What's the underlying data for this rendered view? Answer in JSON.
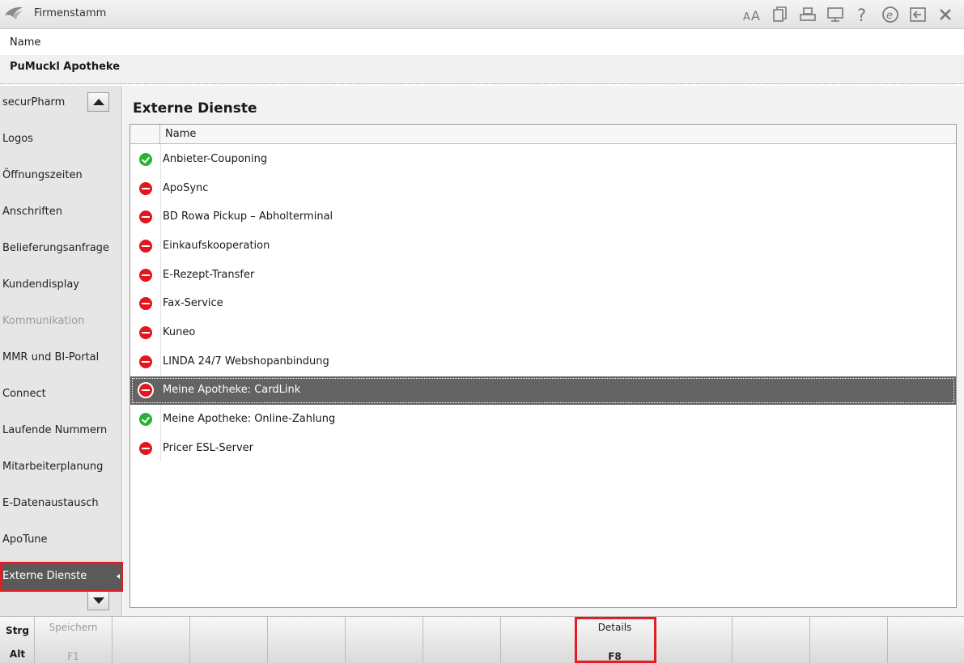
{
  "window": {
    "title": "Firmenstamm"
  },
  "header": {
    "name_label": "Name",
    "name_value": "PuMuckl Apotheke"
  },
  "sidebar": {
    "items": [
      {
        "label": "securPharm",
        "state": "normal"
      },
      {
        "label": "Logos",
        "state": "normal"
      },
      {
        "label": "Öffnungszeiten",
        "state": "normal"
      },
      {
        "label": "Anschriften",
        "state": "normal"
      },
      {
        "label": "Belieferungsanfrage",
        "state": "normal"
      },
      {
        "label": "Kundendisplay",
        "state": "normal"
      },
      {
        "label": "Kommunikation",
        "state": "disabled"
      },
      {
        "label": "MMR und BI-Portal",
        "state": "normal"
      },
      {
        "label": "Connect",
        "state": "normal"
      },
      {
        "label": "Laufende Nummern",
        "state": "normal"
      },
      {
        "label": "Mitarbeiterplanung",
        "state": "normal"
      },
      {
        "label": "E-Datenaustausch",
        "state": "normal"
      },
      {
        "label": "ApoTune",
        "state": "normal"
      },
      {
        "label": "Externe Dienste",
        "state": "active"
      }
    ]
  },
  "main": {
    "title": "Externe Dienste",
    "column_name": "Name",
    "services": [
      {
        "name": "Anbieter-Couponing",
        "status": "ok"
      },
      {
        "name": "ApoSync",
        "status": "error"
      },
      {
        "name": "BD Rowa Pickup – Abholterminal",
        "status": "error"
      },
      {
        "name": "Einkaufskooperation",
        "status": "error"
      },
      {
        "name": "E-Rezept-Transfer",
        "status": "error"
      },
      {
        "name": "Fax-Service",
        "status": "error"
      },
      {
        "name": "Kuneo",
        "status": "error"
      },
      {
        "name": "LINDA 24/7 Webshopanbindung",
        "status": "error"
      },
      {
        "name": "Meine Apotheke: CardLink",
        "status": "error",
        "selected": true
      },
      {
        "name": "Meine Apotheke: Online-Zahlung",
        "status": "ok"
      },
      {
        "name": "Pricer ESL-Server",
        "status": "error"
      }
    ]
  },
  "fkeys": {
    "mod_top": "Strg",
    "mod_bottom": "Alt",
    "f1_label": "Speichern",
    "f1_key": "F1",
    "f8_label": "Details",
    "f8_key": "F8"
  },
  "colors": {
    "ok": "#28b132",
    "error": "#e3161e",
    "selection": "#636363",
    "highlight": "#e01e26"
  }
}
